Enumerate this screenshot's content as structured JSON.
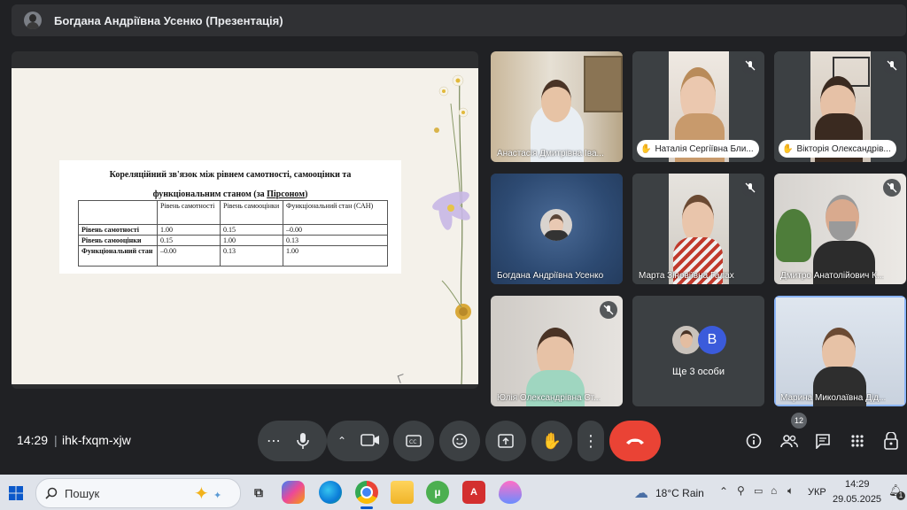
{
  "presenter_bar": {
    "title": "Богдана Андріївна Усенко (Презентація)"
  },
  "slide": {
    "title_line1": "Кореляційний зв'язок між рівнем самотності, самооцінки та",
    "title_line2a": "функціональним станом (за ",
    "title_line2b": "Пірсоном",
    "title_line2c": ")",
    "table": {
      "headers": [
        "",
        "Рівень самотності",
        "Рівень самооцінки",
        "Функціональний стан (САН)"
      ],
      "rows": [
        [
          "Рівень самотності",
          "1.00",
          "0.15",
          "–0.00"
        ],
        [
          "Рівень самооцінки",
          "0.15",
          "1.00",
          "0.13"
        ],
        [
          "Функціональний стан",
          "–0.00",
          "0.13",
          "1.00"
        ]
      ]
    }
  },
  "participants": [
    {
      "name": "Анастасія Дмитрівна Іва..."
    },
    {
      "name": "Наталія Сергіївна Бли..."
    },
    {
      "name": "Вікторія Олександрів..."
    },
    {
      "name": "Богдана Андріївна Усенко"
    },
    {
      "name": "Марта Зіновіївна Галах"
    },
    {
      "name": "Дмитро Анатолійович К..."
    },
    {
      "name": "Юлія Олександрівна Ст..."
    },
    {
      "name": "Ще 3 особи",
      "avatar_letter": "B"
    },
    {
      "name": "Марина Миколаївна Дід..."
    }
  ],
  "meeting": {
    "time": "14:29",
    "separator": "|",
    "code": "ihk-fxqm-xjw",
    "participant_count": "12"
  },
  "taskbar": {
    "search_placeholder": "Пошук",
    "weather": "18°C Rain",
    "language": "УКР",
    "clock_time": "14:29",
    "clock_date": "29.05.2025",
    "notification_count": "1"
  },
  "colors": {
    "accent_blue": "#8ab4f8",
    "end_call_red": "#ea4335",
    "background": "#202124"
  }
}
